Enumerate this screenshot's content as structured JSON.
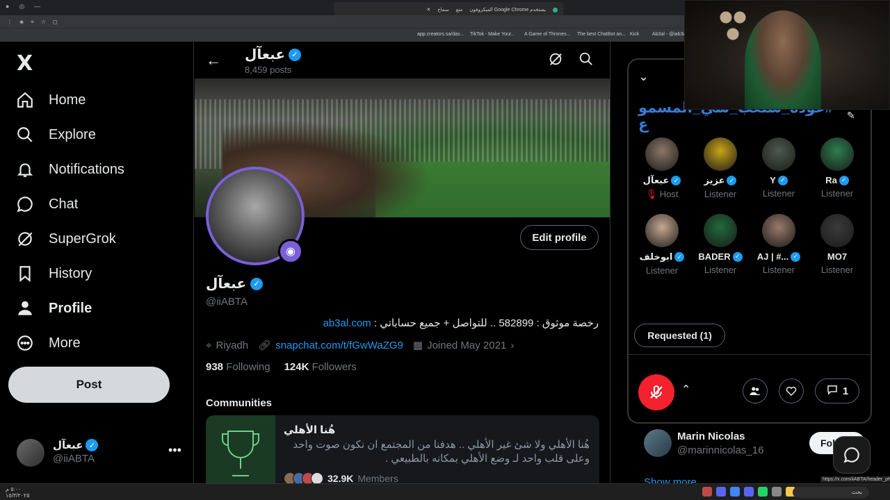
{
  "browser": {
    "notification": "يستخدم Google Chrome الميكروفون",
    "notif_actions": [
      "منع",
      "سماح"
    ],
    "bookmarks": [
      "app.creators.sa/das...",
      "TikTok - Make Your...",
      "A Game of Thrones...",
      "The best ChatBot an...",
      "Kick",
      "Ab3al - @iab3a..."
    ],
    "status_url": "https://x.com/iiABTA/header_photo"
  },
  "nav": {
    "logo": "X",
    "items": [
      {
        "label": "Home",
        "icon": "home-icon"
      },
      {
        "label": "Explore",
        "icon": "search-icon"
      },
      {
        "label": "Notifications",
        "icon": "bell-icon"
      },
      {
        "label": "Chat",
        "icon": "chat-icon"
      },
      {
        "label": "SuperGrok",
        "icon": "grok-icon"
      },
      {
        "label": "History",
        "icon": "bookmark-icon"
      },
      {
        "label": "Profile",
        "icon": "person-icon"
      },
      {
        "label": "More",
        "icon": "more-circle-icon"
      }
    ],
    "post_label": "Post",
    "account": {
      "name": "عبعآل",
      "handle": "@iiABTA",
      "more": "•••"
    }
  },
  "header": {
    "name": "عبعآل",
    "posts": "8,459 posts"
  },
  "profile": {
    "edit_label": "Edit profile",
    "name": "عبعآل",
    "handle": "@iiABTA",
    "bio_text": "رخصة موثوق : 582899 .. للتواصل + جميع حساباتي : ",
    "bio_link": "ab3al.com",
    "location": "Riyadh",
    "website": "snapchat.com/t/fGwWaZG9",
    "joined": "Joined May 2021",
    "following_count": "938",
    "following_label": "Following",
    "followers_count": "124K",
    "followers_label": "Followers"
  },
  "communities": {
    "title": "Communities",
    "card": {
      "name": "هُنا الأهلي",
      "description": "هُنا الأهلي ولا شئ غير الأهلي .. هدفنا من المجتمع ان نكون صوت واحد وعلى قلب واحد لـ وضع الأهلي بمكانه بالطبيعي .",
      "members_count": "32.9K",
      "members_label": "Members"
    }
  },
  "space": {
    "title": "#عوده_سنعب_سي_المسمو ع",
    "speakers": [
      {
        "name": "عبعآل",
        "role": "Host",
        "verified": true,
        "color": "#8a7868"
      },
      {
        "name": "عزيز",
        "role": "Listener",
        "verified": true,
        "color": "#c8a418"
      },
      {
        "name": "Y",
        "role": "Listener",
        "verified": true,
        "color": "#4d5a4d"
      },
      {
        "name": "Ra",
        "role": "Listener",
        "verified": true,
        "color": "#2e7d4f"
      },
      {
        "name": "ابوخلف",
        "role": "Listener",
        "verified": true,
        "color": "#c8a890"
      },
      {
        "name": "BADER",
        "role": "Listener",
        "verified": true,
        "color": "#1f6b3a"
      },
      {
        "name": "AJ | #...",
        "role": "Listener",
        "verified": true,
        "color": "#9a7a6a"
      },
      {
        "name": "MO7",
        "role": "Listener",
        "verified": false,
        "color": "#3a3a3a"
      }
    ],
    "requested_label": "Requested (1)",
    "comments_count": "1"
  },
  "who_to_follow": {
    "name": "Marin Nicolas",
    "handle": "@marinnicolas_16",
    "follow_label": "Fol",
    "show_more": "Show more"
  },
  "taskbar": {
    "time": "٥:٠٠ م",
    "date": "١٥/٣/٢٠٢٥",
    "search": "بحث"
  }
}
